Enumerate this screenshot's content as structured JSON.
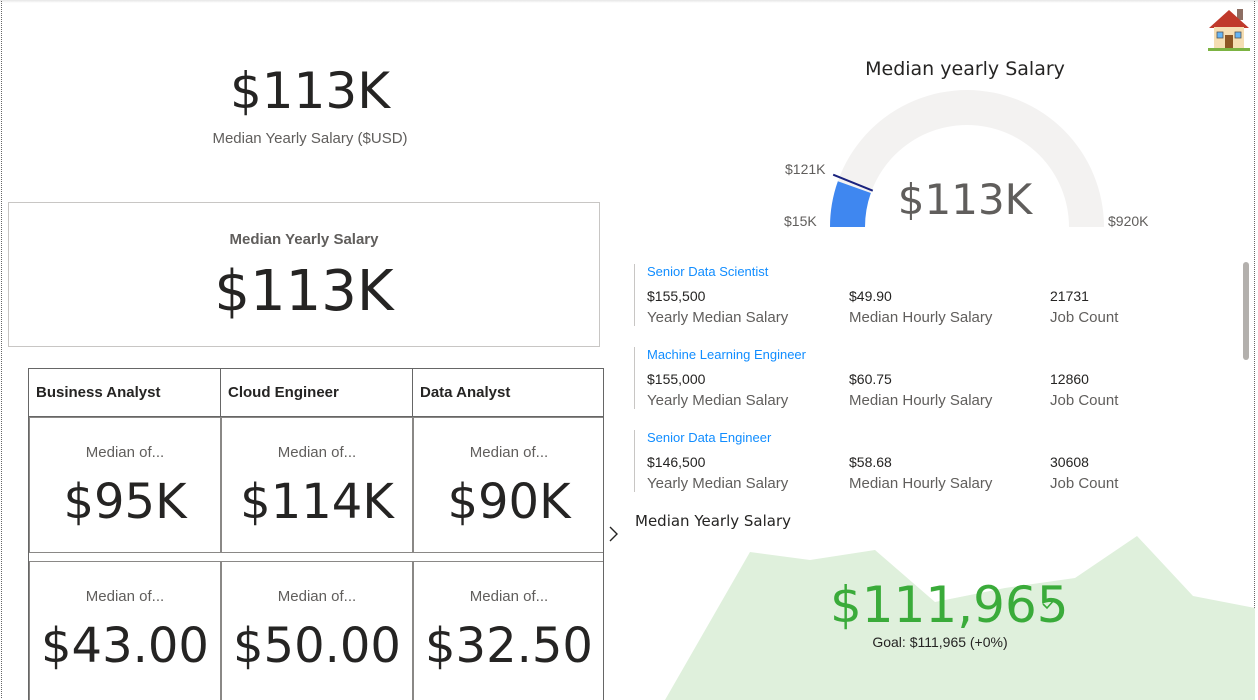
{
  "header": {
    "home_icon": "house-icon"
  },
  "kpi_top": {
    "value": "$113K",
    "caption": "Median Yearly Salary ($USD)"
  },
  "card_main": {
    "title": "Median Yearly Salary",
    "value": "$113K"
  },
  "matrix": {
    "columns": [
      "Business Analyst",
      "Cloud Engineer",
      "Data Analyst"
    ],
    "rows": [
      [
        {
          "label": "Median of...",
          "value": "$95K"
        },
        {
          "label": "Median of...",
          "value": "$114K"
        },
        {
          "label": "Median of...",
          "value": "$90K"
        }
      ],
      [
        {
          "label": "Median of...",
          "value": "$43.00"
        },
        {
          "label": "Median of...",
          "value": "$50.00"
        },
        {
          "label": "Median of...",
          "value": "$32.50"
        }
      ]
    ],
    "next_icon": "chevron-right-icon"
  },
  "gauge": {
    "title": "Median yearly Salary",
    "value_label": "$113K",
    "min_label": "$15K",
    "max_label": "$920K",
    "target_label": "$121K",
    "value": 113,
    "min": 15,
    "max": 920,
    "target": 121,
    "colors": {
      "fill": "#3f87f0",
      "track": "#f3f2f1",
      "target": "#1a237e"
    }
  },
  "multi_row_card": [
    {
      "title": "Senior Data Scientist",
      "yearly": "$155,500",
      "yearly_label": "Yearly Median Salary",
      "hourly": "$49.90",
      "hourly_label": "Median Hourly Salary",
      "count": "21731",
      "count_label": "Job Count"
    },
    {
      "title": "Machine Learning Engineer",
      "yearly": "$155,000",
      "yearly_label": "Yearly Median Salary",
      "hourly": "$60.75",
      "hourly_label": "Median Hourly Salary",
      "count": "12860",
      "count_label": "Job Count"
    },
    {
      "title": "Senior Data Engineer",
      "yearly": "$146,500",
      "yearly_label": "Yearly Median Salary",
      "hourly": "$58.68",
      "hourly_label": "Median Hourly Salary",
      "count": "30608",
      "count_label": "Job Count"
    }
  ],
  "kpi_bottom": {
    "title": "Median Yearly Salary",
    "value": "$111,965",
    "goal": "Goal: $111,965 (+0%)",
    "colors": {
      "value": "#3aab3a",
      "area": "#dff0dc"
    }
  }
}
